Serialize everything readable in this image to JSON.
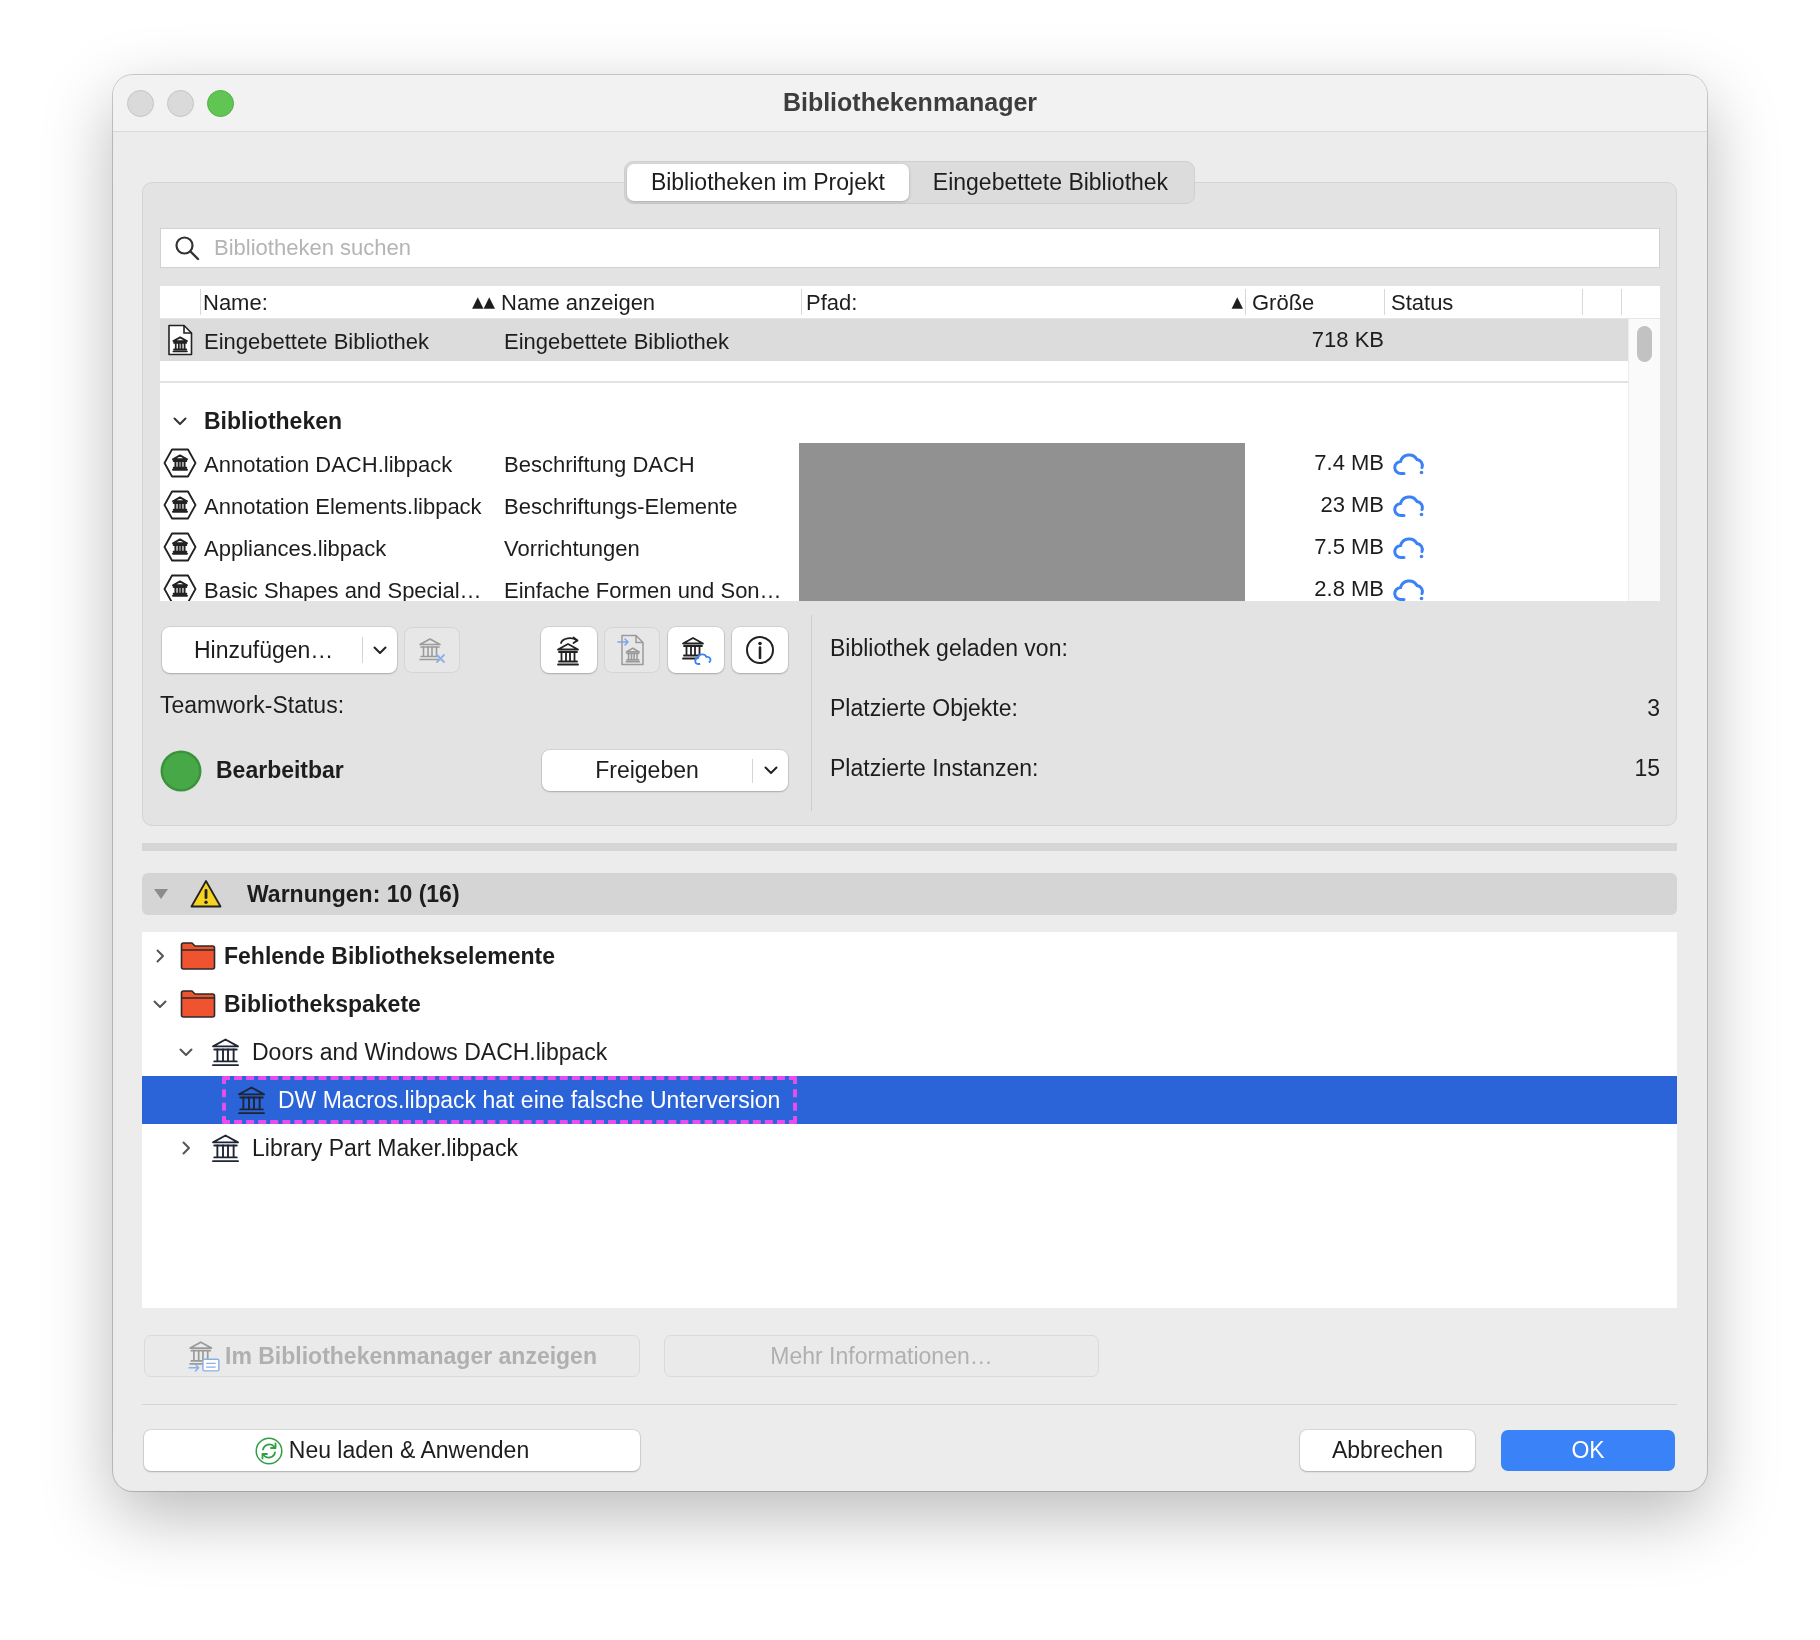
{
  "window": {
    "title": "Bibliothekenmanager"
  },
  "tabs": [
    {
      "label": "Bibliotheken im Projekt",
      "selected": true
    },
    {
      "label": "Eingebettete Bibliothek",
      "selected": false
    }
  ],
  "search": {
    "placeholder": "Bibliotheken suchen"
  },
  "table": {
    "columns": [
      {
        "label": "Name:",
        "sort_indicator": "▲▲"
      },
      {
        "label": "Name anzeigen"
      },
      {
        "label": "Pfad:",
        "sort_indicator": "▲"
      },
      {
        "label": "Größe"
      },
      {
        "label": "Status"
      }
    ],
    "embedded_row": {
      "name": "Eingebettete Bibliothek",
      "display_name": "Eingebettete Bibliothek",
      "size": "718 KB",
      "selected": true
    },
    "group": {
      "label": "Bibliotheken",
      "expanded": true,
      "rows": [
        {
          "name": "Annotation DACH.libpack",
          "display_name": "Beschriftung DACH",
          "size": "7.4 MB",
          "selected": false
        },
        {
          "name": "Annotation Elements.libpack",
          "display_name": "Beschriftungs-Elemente",
          "size": "23 MB",
          "selected": false
        },
        {
          "name": "Appliances.libpack",
          "display_name": "Vorrichtungen",
          "size": "7.5 MB",
          "selected": false
        },
        {
          "name": "Basic Shapes and Special…",
          "display_name": "Einfache Formen und Son…",
          "size": "2.8 MB",
          "selected": false
        }
      ]
    }
  },
  "library_buttons": {
    "add_button": "Hinzufügen…",
    "tools": [
      {
        "kind": "bank-cross",
        "disabled": true
      },
      {
        "kind": "bank-arrow",
        "disabled": false
      },
      {
        "kind": "document-arrow",
        "disabled": true
      },
      {
        "kind": "bank-cloud",
        "disabled": false
      },
      {
        "kind": "info",
        "disabled": false
      }
    ]
  },
  "teamwork": {
    "label": "Teamwork-Status:",
    "state": "Bearbeitbar",
    "button": "Freigeben"
  },
  "details": [
    {
      "label": "Bibliothek geladen von:"
    },
    {
      "label": "Platzierte Objekte:",
      "value": "3"
    },
    {
      "label": "Platzierte Instanzen:",
      "value": "15"
    }
  ],
  "warnings": {
    "title": "Warnungen: 10 (16)",
    "expanded": true,
    "tree": [
      {
        "label": "Fehlende Bibliothekselemente",
        "kind": "folder",
        "expanded": false,
        "selected": false,
        "highlighted": false
      },
      {
        "label": "Bibliothekspakete",
        "kind": "folder",
        "expanded": true,
        "selected": false,
        "highlighted": false,
        "children": [
          {
            "label": "Doors and Windows DACH.libpack",
            "kind": "package",
            "expanded": true,
            "selected": false,
            "highlighted": false,
            "children": [
              {
                "label": "DW Macros.libpack hat eine falsche Unterversion",
                "kind": "package",
                "selected": true,
                "highlighted": true
              }
            ]
          },
          {
            "label": "Library Part Maker.libpack",
            "kind": "package",
            "expanded": false,
            "selected": false,
            "highlighted": false
          }
        ]
      }
    ]
  },
  "actions": [
    {
      "label": "Im Bibliothekenmanager anzeigen",
      "kind": "icon",
      "disabled": true
    },
    {
      "label": "Mehr Informationen…",
      "kind": "plain",
      "disabled": true
    }
  ],
  "footer": {
    "reload_button": "Neu laden & Anwenden",
    "cancel_button": "Abbrechen",
    "ok_button": "OK"
  }
}
